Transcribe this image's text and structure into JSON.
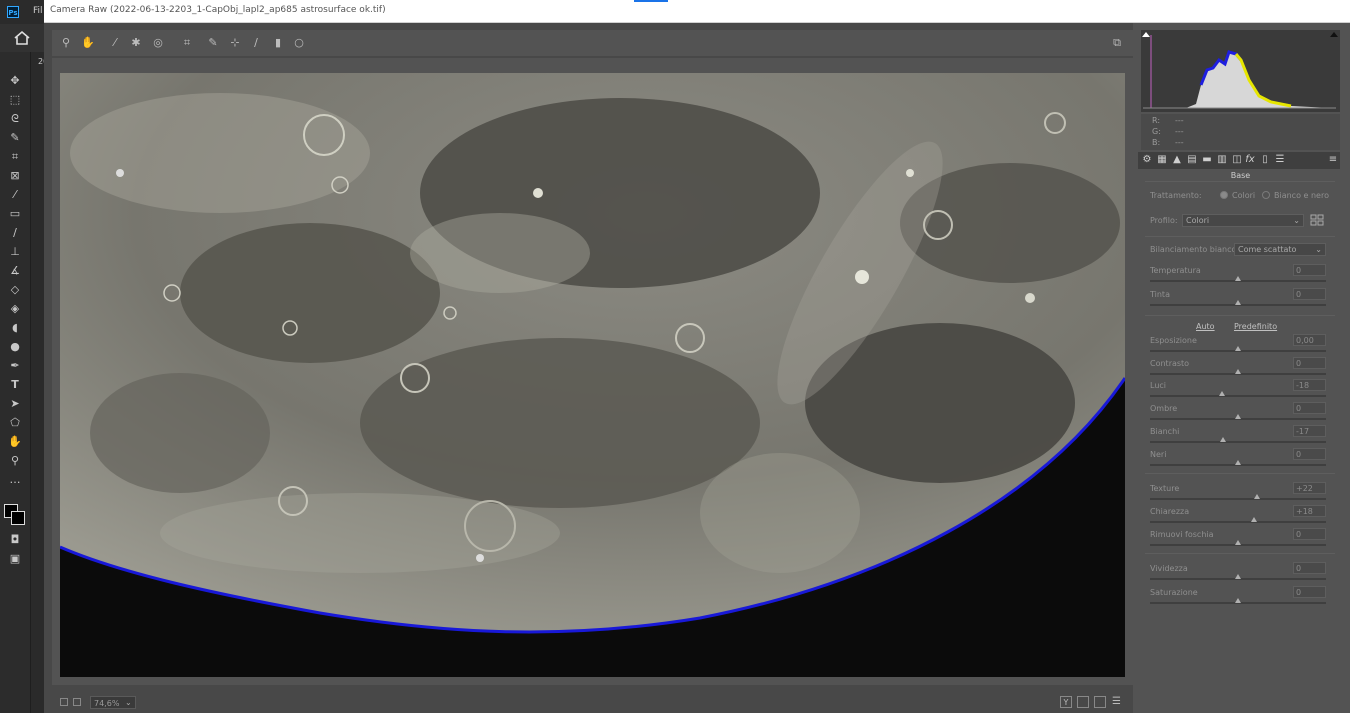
{
  "app": {
    "menu_file": "Fil",
    "window_title": "Camera Raw (2022-06-13-2203_1-CapObj_lapl2_ap685 astrosurface ok.tif)",
    "doc_tab": "20"
  },
  "histogram": {
    "rgb_labels": {
      "r": "R:",
      "g": "G:",
      "b": "B:"
    },
    "rgb_values": {
      "r": "---",
      "g": "---",
      "b": "---"
    }
  },
  "panel": {
    "title": "Base",
    "treatment_label": "Trattamento:",
    "treatment_options": [
      "Colori",
      "Bianco e nero"
    ],
    "profile_label": "Profilo:",
    "profile_value": "Colori",
    "wb_label": "Bilanciamento bianco:",
    "wb_value": "Come scattato",
    "auto_link": "Auto",
    "default_link": "Predefinito",
    "sliders": [
      {
        "label": "Temperatura",
        "value": "0",
        "pos": 0.5
      },
      {
        "label": "Tinta",
        "value": "0",
        "pos": 0.5
      },
      {
        "label": "Esposizione",
        "value": "0,00",
        "pos": 0.5
      },
      {
        "label": "Contrasto",
        "value": "0",
        "pos": 0.5
      },
      {
        "label": "Luci",
        "value": "-18",
        "pos": 0.41
      },
      {
        "label": "Ombre",
        "value": "0",
        "pos": 0.5
      },
      {
        "label": "Bianchi",
        "value": "-17",
        "pos": 0.415
      },
      {
        "label": "Neri",
        "value": "0",
        "pos": 0.5
      },
      {
        "label": "Texture",
        "value": "+22",
        "pos": 0.61
      },
      {
        "label": "Chiarezza",
        "value": "+18",
        "pos": 0.59
      },
      {
        "label": "Rimuovi foschia",
        "value": "0",
        "pos": 0.5
      },
      {
        "label": "Vividezza",
        "value": "0",
        "pos": 0.5
      },
      {
        "label": "Saturazione",
        "value": "0",
        "pos": 0.5
      }
    ]
  },
  "footer": {
    "zoom": "74,6%"
  }
}
